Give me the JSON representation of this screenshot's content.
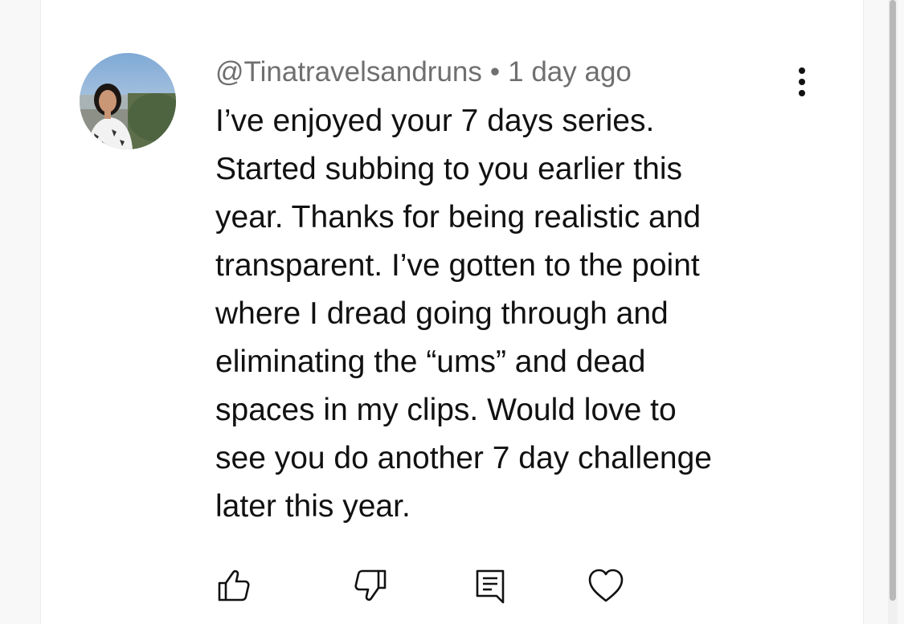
{
  "comment": {
    "author": "@Tinatravelsandruns",
    "separator": "•",
    "timestamp": "1 day ago",
    "body": "I’ve enjoyed your 7 days series.\nStarted subbing to you earlier this\nyear.  Thanks for being realistic and\ntransparent.  I’ve gotten to the point\nwhere I dread going through and\neliminating the “ums” and dead\nspaces in my clips.  Would love to\nsee you do another 7 day challenge\nlater this year."
  },
  "icons": {
    "menu": "more-vert-icon",
    "like": "thumbs-up-icon",
    "dislike": "thumbs-down-icon",
    "reply": "reply-comment-icon",
    "heart": "heart-icon"
  },
  "colors": {
    "text": "#111111",
    "meta": "#6f6f6f",
    "icon": "#111111"
  }
}
